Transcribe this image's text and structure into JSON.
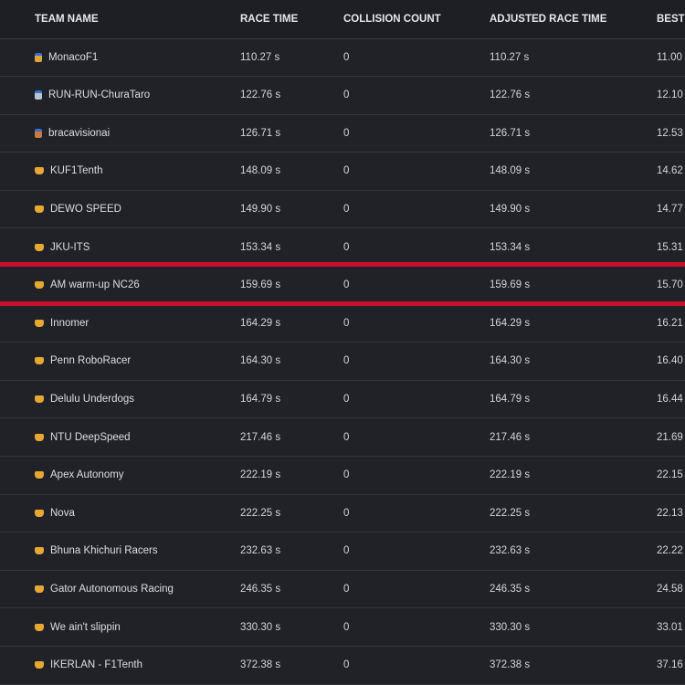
{
  "table": {
    "headers": {
      "team": "TEAM NAME",
      "race": "RACE TIME",
      "collision": "COLLISION COUNT",
      "adjusted": "ADJUSTED RACE TIME",
      "best": "BEST"
    },
    "rows": [
      {
        "team": "MonacoF1",
        "icon": "gold-medal-icon",
        "race": "110.27 s",
        "collision": "0",
        "adjusted": "110.27 s",
        "best": "11.00"
      },
      {
        "team": "RUN-RUN-ChuraTaro",
        "icon": "silver-medal-icon",
        "race": "122.76 s",
        "collision": "0",
        "adjusted": "122.76 s",
        "best": "12.10"
      },
      {
        "team": "bracavisionai",
        "icon": "bronze-medal-icon",
        "race": "126.71 s",
        "collision": "0",
        "adjusted": "126.71 s",
        "best": "12.53"
      },
      {
        "team": "KUF1Tenth",
        "icon": "sports-medal-icon",
        "race": "148.09 s",
        "collision": "0",
        "adjusted": "148.09 s",
        "best": "14.62"
      },
      {
        "team": "DEWO SPEED",
        "icon": "sports-medal-icon",
        "race": "149.90 s",
        "collision": "0",
        "adjusted": "149.90 s",
        "best": "14.77"
      },
      {
        "team": "JKU-ITS",
        "icon": "sports-medal-icon",
        "race": "153.34 s",
        "collision": "0",
        "adjusted": "153.34 s",
        "best": "15.31"
      },
      {
        "team": "AM warm-up NC26",
        "icon": "sports-medal-icon",
        "race": "159.69 s",
        "collision": "0",
        "adjusted": "159.69 s",
        "best": "15.70"
      },
      {
        "team": "Innomer",
        "icon": "sports-medal-icon",
        "race": "164.29 s",
        "collision": "0",
        "adjusted": "164.29 s",
        "best": "16.21"
      },
      {
        "team": "Penn RoboRacer",
        "icon": "sports-medal-icon",
        "race": "164.30 s",
        "collision": "0",
        "adjusted": "164.30 s",
        "best": "16.40"
      },
      {
        "team": "Delulu Underdogs",
        "icon": "sports-medal-icon",
        "race": "164.79 s",
        "collision": "0",
        "adjusted": "164.79 s",
        "best": "16.44"
      },
      {
        "team": "NTU DeepSpeed",
        "icon": "sports-medal-icon",
        "race": "217.46 s",
        "collision": "0",
        "adjusted": "217.46 s",
        "best": "21.69"
      },
      {
        "team": "Apex Autonomy",
        "icon": "sports-medal-icon",
        "race": "222.19 s",
        "collision": "0",
        "adjusted": "222.19 s",
        "best": "22.15"
      },
      {
        "team": "Nova",
        "icon": "sports-medal-icon",
        "race": "222.25 s",
        "collision": "0",
        "adjusted": "222.25 s",
        "best": "22.13"
      },
      {
        "team": "Bhuna Khichuri Racers",
        "icon": "sports-medal-icon",
        "race": "232.63 s",
        "collision": "0",
        "adjusted": "232.63 s",
        "best": "22.22"
      },
      {
        "team": "Gator Autonomous Racing",
        "icon": "sports-medal-icon",
        "race": "246.35 s",
        "collision": "0",
        "adjusted": "246.35 s",
        "best": "24.58"
      },
      {
        "team": "We ain't slippin",
        "icon": "sports-medal-icon",
        "race": "330.30 s",
        "collision": "0",
        "adjusted": "330.30 s",
        "best": "33.01"
      },
      {
        "team": "IKERLAN - F1Tenth",
        "icon": "sports-medal-icon",
        "race": "372.38 s",
        "collision": "0",
        "adjusted": "372.38 s",
        "best": "37.16"
      }
    ]
  },
  "highlight": {
    "row_index": 6,
    "color": "#c8102e"
  },
  "colors": {
    "background": "#202228",
    "header_background": "#1d1f24",
    "row_divider": "#34363c",
    "text": "#d4d6da"
  }
}
